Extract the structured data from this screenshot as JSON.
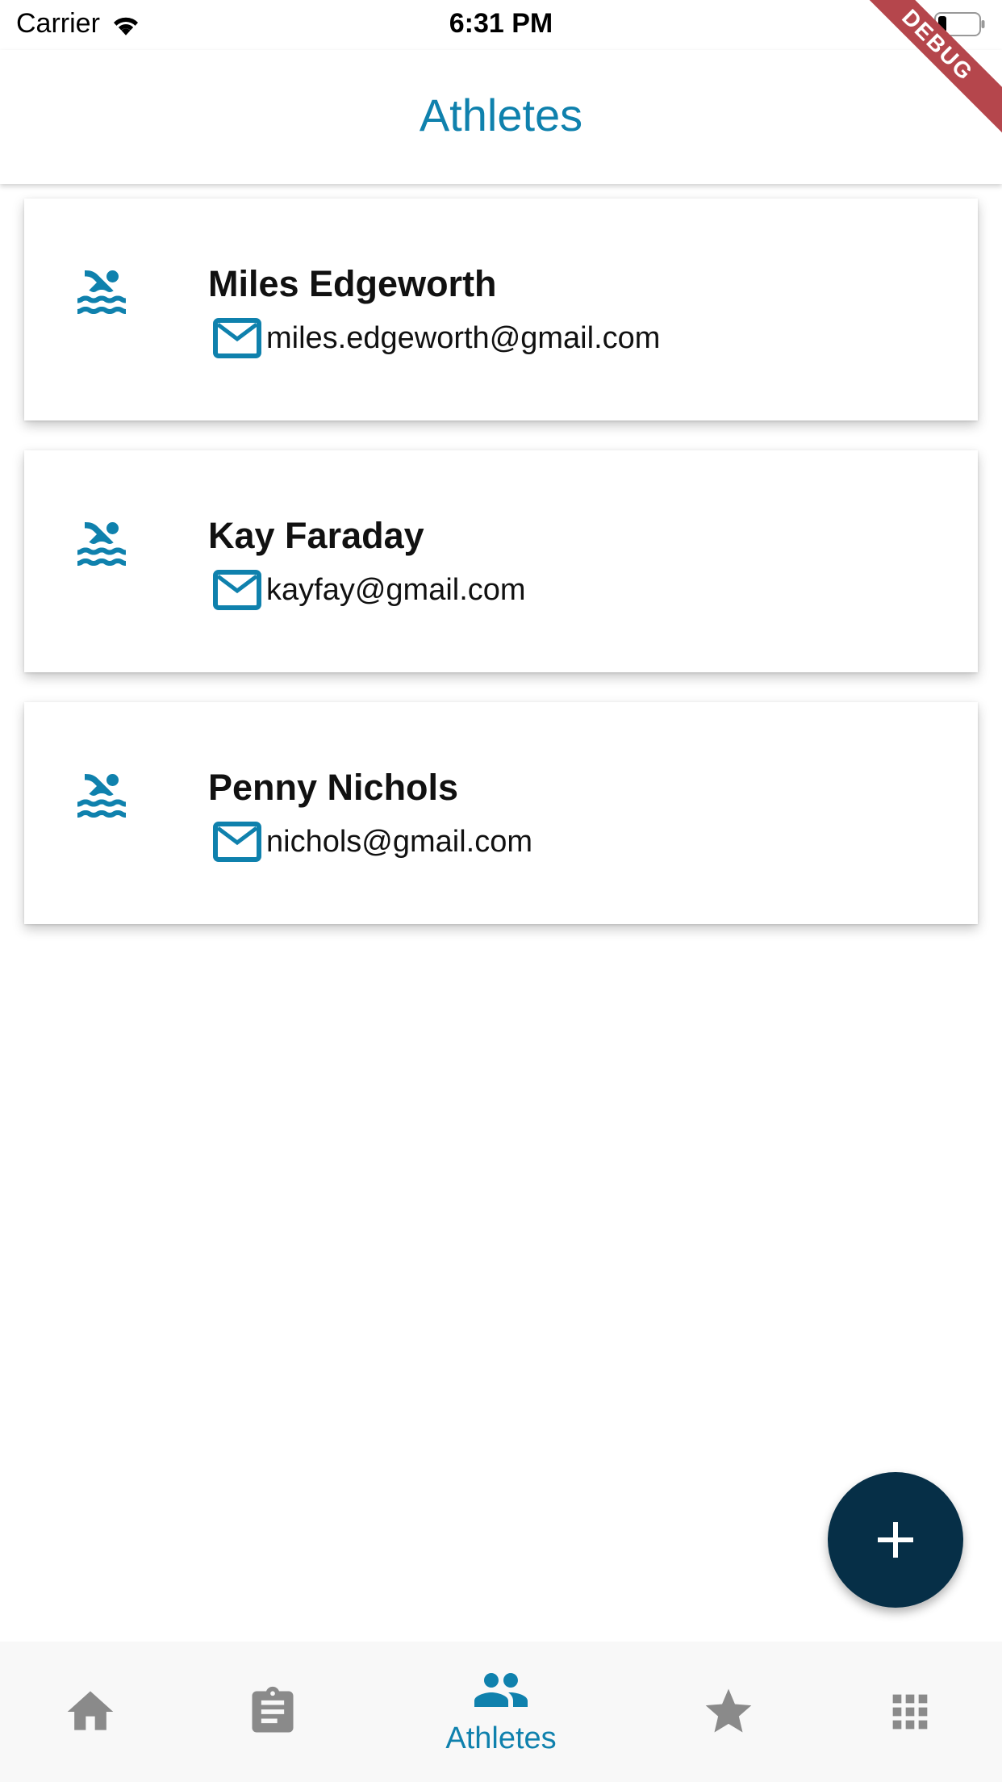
{
  "status_bar": {
    "carrier": "Carrier",
    "time": "6:31 PM"
  },
  "debug_banner": "DEBUG",
  "app_bar": {
    "title": "Athletes"
  },
  "athletes": [
    {
      "name": "Miles Edgeworth",
      "email": "miles.edgeworth@gmail.com",
      "icon": "pool-icon"
    },
    {
      "name": "Kay Faraday",
      "email": "kayfay@gmail.com",
      "icon": "pool-icon"
    },
    {
      "name": "Penny Nichols",
      "email": "nichols@gmail.com",
      "icon": "pool-icon"
    }
  ],
  "fab": {
    "icon": "add-icon"
  },
  "bottom_nav": {
    "items": [
      {
        "icon": "home-icon",
        "label": ""
      },
      {
        "icon": "assignment-icon",
        "label": ""
      },
      {
        "icon": "people-icon",
        "label": "Athletes",
        "active": true
      },
      {
        "icon": "star-icon",
        "label": ""
      },
      {
        "icon": "apps-icon",
        "label": ""
      }
    ]
  },
  "colors": {
    "accent": "#0f81ad",
    "fab": "#062f47",
    "inactive_icon": "#8a8a8a",
    "debug_ribbon": "#b5464c"
  }
}
